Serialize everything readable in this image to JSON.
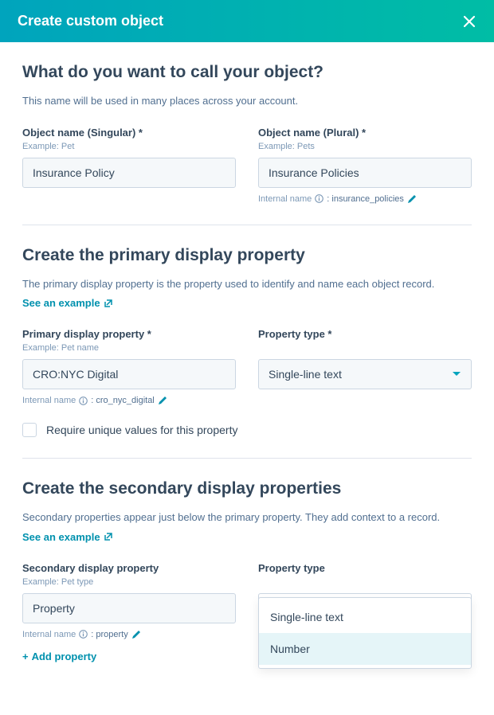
{
  "header": {
    "title": "Create custom object"
  },
  "section1": {
    "title": "What do you want to call your object?",
    "description": "This name will be used in many places across your account.",
    "singular": {
      "label": "Object name (Singular) *",
      "example": "Example: Pet",
      "value": "Insurance Policy"
    },
    "plural": {
      "label": "Object name (Plural) *",
      "example": "Example: Pets",
      "value": "Insurance Policies",
      "internal_label": "Internal name",
      "internal_value": ": insurance_policies"
    }
  },
  "section2": {
    "title": "Create the primary display property",
    "description": "The primary display property is the property used to identify and name each object record.",
    "see_example": "See an example",
    "primary": {
      "label": "Primary display property *",
      "example": "Example: Pet name",
      "value": "CRO:NYC Digital",
      "internal_label": "Internal name",
      "internal_value": ": cro_nyc_digital"
    },
    "type": {
      "label": "Property type *",
      "value": "Single-line text"
    },
    "checkbox_label": "Require unique values for this property"
  },
  "section3": {
    "title": "Create the secondary display properties",
    "description": "Secondary properties appear just below the primary property. They add context to a record.",
    "see_example": "See an example",
    "secondary": {
      "label": "Secondary display property",
      "example": "Example: Pet type",
      "value": "Property",
      "internal_label": "Internal name",
      "internal_value": ": property"
    },
    "type": {
      "label": "Property type",
      "value": "Single-line text",
      "options": [
        "Single-line text",
        "Number"
      ]
    },
    "add_property": "Add property"
  }
}
